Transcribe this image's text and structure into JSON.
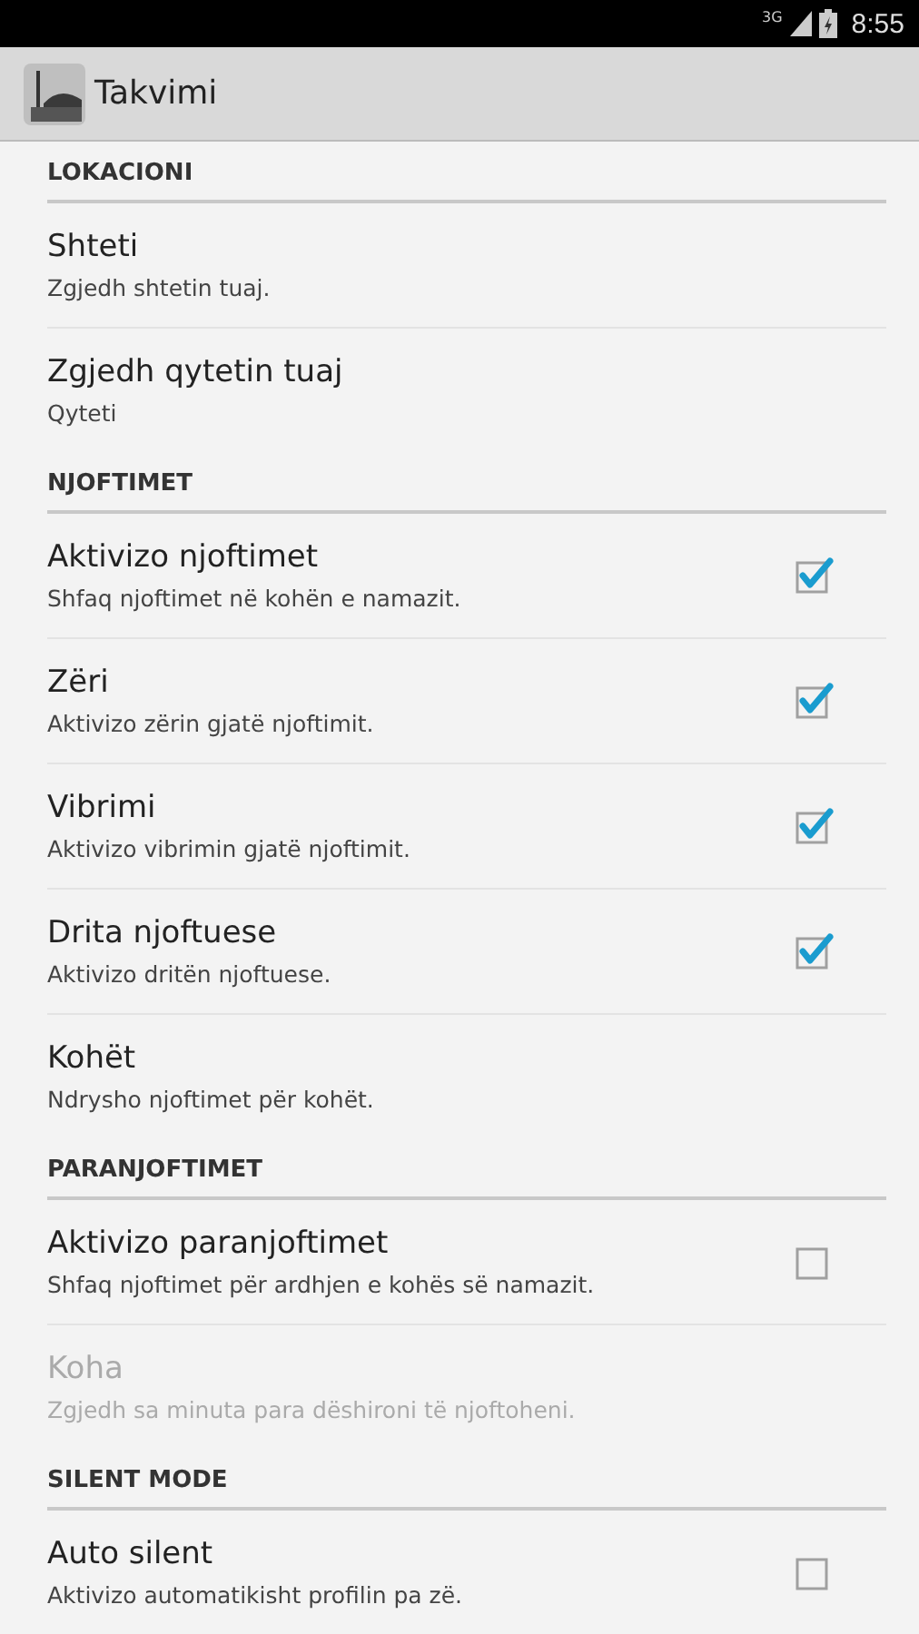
{
  "status_bar": {
    "network": "3G",
    "time": "8:55"
  },
  "action_bar": {
    "title": "Takvimi"
  },
  "categories": [
    {
      "title": "LOKACIONI",
      "items": [
        {
          "kind": "plain",
          "title": "Shteti",
          "summary": "Zgjedh shtetin tuaj.",
          "disabled": false
        },
        {
          "kind": "plain",
          "title": "Zgjedh qytetin tuaj",
          "summary": "Qyteti",
          "disabled": false
        }
      ]
    },
    {
      "title": "NJOFTIMET",
      "items": [
        {
          "kind": "checkbox",
          "title": "Aktivizo njoftimet",
          "summary": "Shfaq njoftimet në kohën e namazit.",
          "disabled": false,
          "checked": true
        },
        {
          "kind": "checkbox",
          "title": "Zëri",
          "summary": "Aktivizo zërin gjatë njoftimit.",
          "disabled": false,
          "checked": true
        },
        {
          "kind": "checkbox",
          "title": "Vibrimi",
          "summary": "Aktivizo vibrimin gjatë njoftimit.",
          "disabled": false,
          "checked": true
        },
        {
          "kind": "checkbox",
          "title": "Drita njoftuese",
          "summary": "Aktivizo dritën njoftuese.",
          "disabled": false,
          "checked": true
        },
        {
          "kind": "plain",
          "title": "Kohët",
          "summary": "Ndrysho njoftimet për kohët.",
          "disabled": false
        }
      ]
    },
    {
      "title": "PARANJOFTIMET",
      "items": [
        {
          "kind": "checkbox",
          "title": "Aktivizo paranjoftimet",
          "summary": "Shfaq njoftimet për ardhjen e kohës së namazit.",
          "disabled": false,
          "checked": false
        },
        {
          "kind": "plain",
          "title": "Koha",
          "summary": "Zgjedh sa minuta para dëshironi të njoftoheni.",
          "disabled": true
        }
      ]
    },
    {
      "title": "SILENT MODE",
      "items": [
        {
          "kind": "checkbox",
          "title": "Auto silent",
          "summary": "Aktivizo automatikisht profilin pa zë.",
          "disabled": false,
          "checked": false
        }
      ]
    }
  ]
}
